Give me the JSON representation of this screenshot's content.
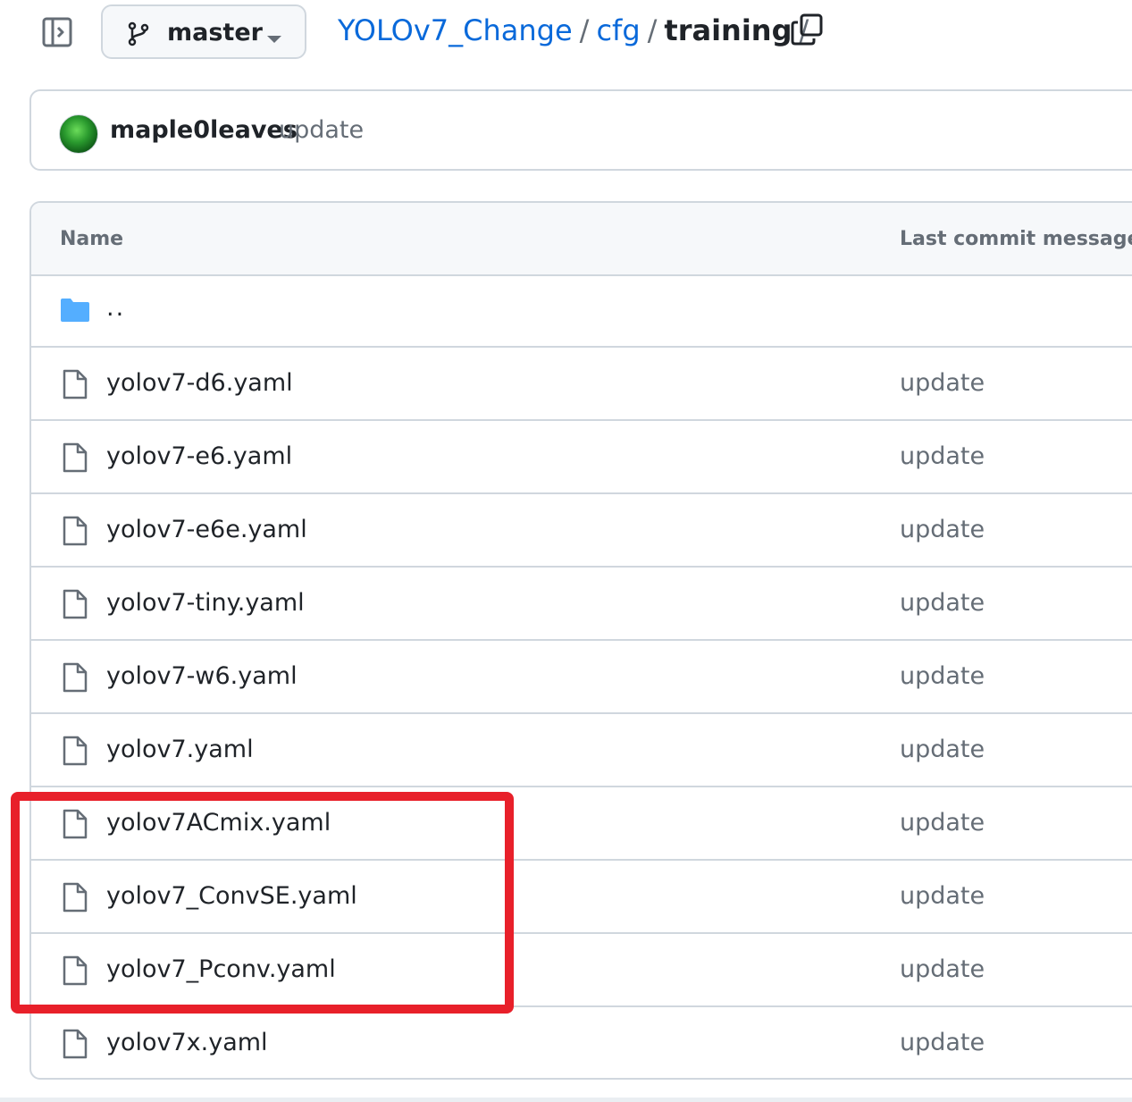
{
  "header": {
    "panel_toggle_icon": "sidebar-expand-icon",
    "branch": {
      "icon": "git-branch-icon",
      "label": "master",
      "caret_icon": "triangle-down-icon"
    },
    "breadcrumb": {
      "repo": "YOLOv7_Change",
      "sep1": "/",
      "folder": "cfg",
      "sep2": "/",
      "current": "training",
      "sep3": "/"
    },
    "copy_icon": "copy-path-icon"
  },
  "latest_commit": {
    "author": "maple0leaves",
    "message": "update"
  },
  "file_table": {
    "columns": {
      "name": "Name",
      "message": "Last commit message"
    },
    "parent_dir": "..",
    "files": [
      {
        "name": "yolov7-d6.yaml",
        "message": "update"
      },
      {
        "name": "yolov7-e6.yaml",
        "message": "update"
      },
      {
        "name": "yolov7-e6e.yaml",
        "message": "update"
      },
      {
        "name": "yolov7-tiny.yaml",
        "message": "update"
      },
      {
        "name": "yolov7-w6.yaml",
        "message": "update"
      },
      {
        "name": "yolov7.yaml",
        "message": "update"
      },
      {
        "name": "yolov7ACmix.yaml",
        "message": "update"
      },
      {
        "name": "yolov7_ConvSE.yaml",
        "message": "update"
      },
      {
        "name": "yolov7_Pconv.yaml",
        "message": "update"
      },
      {
        "name": "yolov7x.yaml",
        "message": "update"
      }
    ]
  },
  "colors": {
    "link": "#0969da",
    "text": "#1f2328",
    "muted": "#656d76",
    "border": "#d0d7de",
    "folder": "#54aeff",
    "highlight": "#e8202a"
  }
}
